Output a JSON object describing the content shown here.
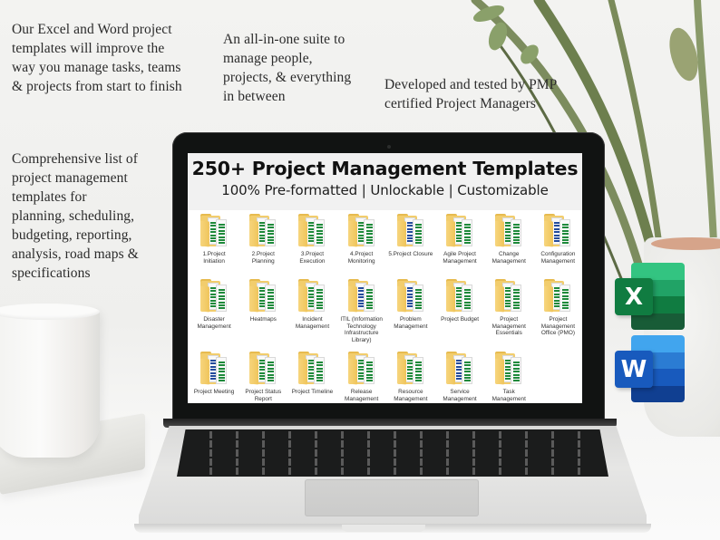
{
  "blurbs": {
    "top_left": "Our Excel and Word project\ntemplates will improve the\nway you manage tasks, teams\n& projects from start to finish",
    "top_middle": "An all-in-one suite to\nmanage people,\nprojects, & everything\nin between",
    "top_right": "Developed and tested by PMP\ncertified Project Managers",
    "left": "Comprehensive list of\nproject management\ntemplates for\nplanning, scheduling,\nbudgeting, reporting,\nanalysis, road maps &\nspecifications"
  },
  "screen": {
    "title": "250+ Project Management Templates",
    "subtitle": "100% Pre-formatted | Unlockable | Customizable",
    "folders": [
      {
        "label": "1.Project\nInitiation",
        "doc_color": "green"
      },
      {
        "label": "2.Project\nPlanning",
        "doc_color": "green"
      },
      {
        "label": "3.Project\nExecution",
        "doc_color": "green"
      },
      {
        "label": "4.Project\nMonitoring",
        "doc_color": "green"
      },
      {
        "label": "5.Project Closure",
        "doc_color": "blue"
      },
      {
        "label": "Agile Project\nManagement",
        "doc_color": "green"
      },
      {
        "label": "Change\nManagement",
        "doc_color": "green"
      },
      {
        "label": "Configuration\nManagement",
        "doc_color": "blue"
      },
      {
        "label": "Disaster\nManagement",
        "doc_color": "green"
      },
      {
        "label": "Heatmaps",
        "doc_color": "green"
      },
      {
        "label": "Incident\nManagement",
        "doc_color": "green"
      },
      {
        "label": "ITIL (Information\nTechnology\nInfrastructure\nLibrary)",
        "doc_color": "blue"
      },
      {
        "label": "Problem\nManagement",
        "doc_color": "blue"
      },
      {
        "label": "Project Budget",
        "doc_color": "green"
      },
      {
        "label": "Project\nManagement\nEssentials",
        "doc_color": "green"
      },
      {
        "label": "Project\nManagement\nOffice (PMO)",
        "doc_color": "green"
      },
      {
        "label": "Project Meeting",
        "doc_color": "blue"
      },
      {
        "label": "Project Status\nReport",
        "doc_color": "green"
      },
      {
        "label": "Project Timeline",
        "doc_color": "green"
      },
      {
        "label": "Release\nManagement",
        "doc_color": "green"
      },
      {
        "label": "Resource\nManagement",
        "doc_color": "green"
      },
      {
        "label": "Service\nManagement",
        "doc_color": "blue"
      },
      {
        "label": "Task\nManagement",
        "doc_color": "green"
      }
    ]
  },
  "apps": {
    "excel": {
      "letter": "X",
      "colors": [
        "#33c481",
        "#21a366",
        "#107c41",
        "#185c37"
      ],
      "badge": "#107c41"
    },
    "word": {
      "letter": "W",
      "colors": [
        "#41a5ee",
        "#2b7cd3",
        "#185abd",
        "#103f91"
      ],
      "badge": "#185abd"
    }
  },
  "colors": {
    "folder": "#f2cd6d",
    "doc_green": "#1f8a3b",
    "doc_blue": "#244c9c"
  }
}
